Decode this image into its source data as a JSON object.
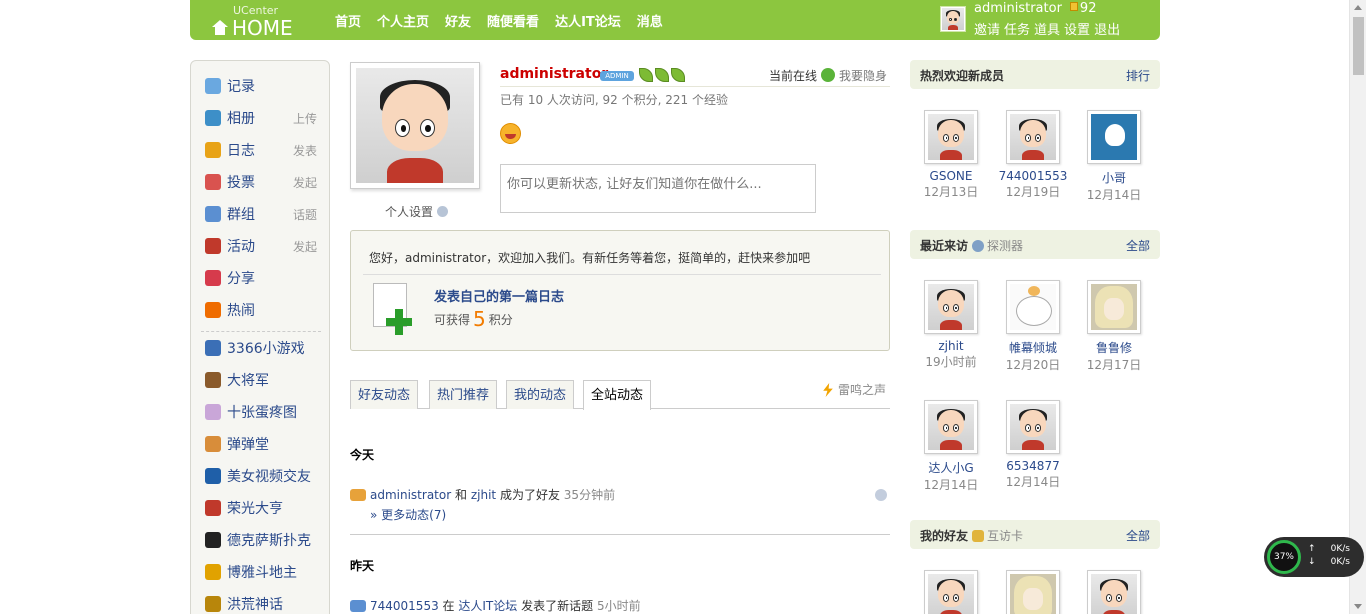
{
  "header": {
    "logo_sub": "UCenter",
    "logo_main": "HOME",
    "nav": [
      "首页",
      "个人主页",
      "好友",
      "随便看看",
      "达人IT论坛",
      "消息"
    ],
    "username": "administrator",
    "credits": "92",
    "user_links": [
      "邀请",
      "任务",
      "道具",
      "设置",
      "退出"
    ]
  },
  "sidebar": {
    "items": [
      {
        "label": "记录",
        "extra": "",
        "icon": "record-icon",
        "color": "#6aa8e0"
      },
      {
        "label": "相册",
        "extra": "上传",
        "icon": "album-icon",
        "color": "#3d8fc8"
      },
      {
        "label": "日志",
        "extra": "发表",
        "icon": "blog-icon",
        "color": "#e8a317"
      },
      {
        "label": "投票",
        "extra": "发起",
        "icon": "poll-icon",
        "color": "#d9534f"
      },
      {
        "label": "群组",
        "extra": "话题",
        "icon": "group-icon",
        "color": "#5b8fd1"
      },
      {
        "label": "活动",
        "extra": "发起",
        "icon": "event-icon",
        "color": "#c0392b"
      },
      {
        "label": "分享",
        "extra": "",
        "icon": "share-icon",
        "color": "#d63b4c"
      },
      {
        "label": "热闹",
        "extra": "",
        "icon": "hot-icon",
        "color": "#ef6c00"
      }
    ],
    "apps": [
      {
        "label": "3366小游戏",
        "icon": "game-3366-icon",
        "color": "#3b6fb6"
      },
      {
        "label": "大将军",
        "icon": "general-icon",
        "color": "#8a5a2b"
      },
      {
        "label": "十张蛋疼图",
        "icon": "pictures-icon",
        "color": "#c9a6d8"
      },
      {
        "label": "弹弹堂",
        "icon": "ddt-icon",
        "color": "#d88d3a"
      },
      {
        "label": "美女视频交友",
        "icon": "video-icon",
        "color": "#1f5fa8"
      },
      {
        "label": "荣光大亨",
        "icon": "tycoon-icon",
        "color": "#c0392b"
      },
      {
        "label": "德克萨斯扑克",
        "icon": "poker-icon",
        "color": "#222222"
      },
      {
        "label": "博雅斗地主",
        "icon": "landlord-icon",
        "color": "#e1a200"
      },
      {
        "label": "洪荒神话",
        "icon": "myth-icon",
        "color": "#b8860b"
      }
    ]
  },
  "profile": {
    "name": "administrator",
    "badge": "ADMIN",
    "online": "当前在线",
    "hide": "我要隐身",
    "stats": "已有 10 人次访问, 92 个积分, 221 个经验",
    "settings": "个人设置",
    "status_placeholder": "你可以更新状态, 让好友们知道你在做什么..."
  },
  "task": {
    "welcome": "您好，administrator，欢迎加入我们。有新任务等着您，挺简单的，赶快来参加吧",
    "title": "发表自己的第一篇日志",
    "reward_pre": "可获得",
    "reward_num": "5",
    "reward_post": "积分"
  },
  "tabs": [
    "好友动态",
    "热门推荐",
    "我的动态",
    "全站动态"
  ],
  "thunder": "雷鸣之声",
  "feed": {
    "today": "今天",
    "item1": {
      "user": "administrator",
      "and": "和",
      "friend": "zjhit",
      "action": "成为了好友",
      "time": "35分钟前"
    },
    "more": "» 更多动态(7)",
    "yesterday": "昨天",
    "item2": {
      "user": "744001553",
      "in": "在",
      "forum": "达人IT论坛",
      "action": "发表了新话题",
      "time": "5小时前"
    }
  },
  "right": {
    "new_members": {
      "title": "热烈欢迎新成员",
      "link": "排行",
      "members": [
        {
          "name": "GSONE",
          "date": "12月13日"
        },
        {
          "name": "744001553",
          "date": "12月19日"
        },
        {
          "name": "小哥",
          "date": "12月14日"
        }
      ]
    },
    "visitors": {
      "title": "最近来访",
      "aux": "探测器",
      "link": "全部",
      "members": [
        {
          "name": "zjhit",
          "date": "19小时前"
        },
        {
          "name": "帷幕倾城",
          "date": "12月20日"
        },
        {
          "name": "鲁鲁修",
          "date": "12月17日"
        },
        {
          "name": "达人小G",
          "date": "12月14日"
        },
        {
          "name": "6534877",
          "date": "12月14日"
        }
      ]
    },
    "friends": {
      "title": "我的好友",
      "aux": "互访卡",
      "link": "全部"
    }
  },
  "netwidget": {
    "percent": "37%",
    "up": "0K/s",
    "down": "0K/s"
  }
}
